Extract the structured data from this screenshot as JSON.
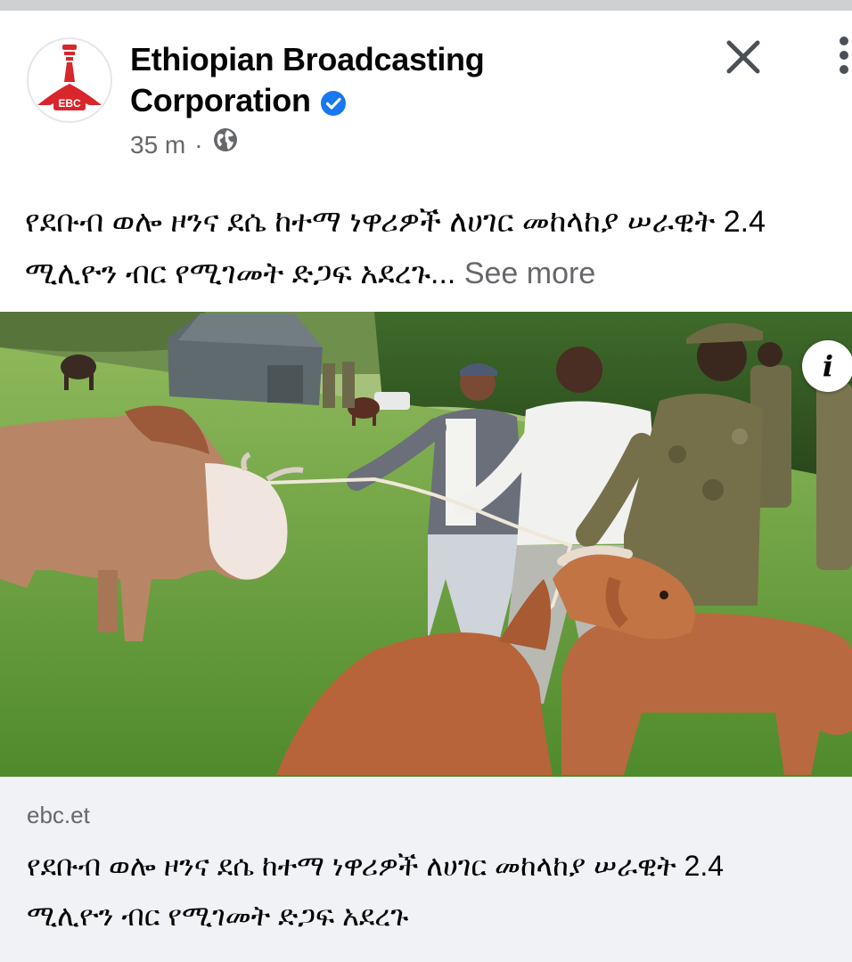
{
  "post": {
    "page_name_line1": "Ethiopian Broadcasting",
    "page_name_line2": "Corporation",
    "time": "35 m",
    "separator": "·",
    "avatar_logo_text": "EBC",
    "verified_icon": "verified-badge-icon",
    "audience_icon": "globe-icon",
    "text_line1": "የደቡብ ወሎ ዞንና ደሴ ከተማ ነዋሪዎች ለሀገር መከላከያ ሠራዊት 2.4",
    "text_line2": "ሚሊዮን ብር የሚገመት ድጋፍ አደረጉ...",
    "see_more": "See more"
  },
  "photo": {
    "description_icon": "info-icon",
    "info_label": "i"
  },
  "link_card": {
    "domain": "ebc.et",
    "title_line1": "የደቡብ ወሎ ዞንና ደሴ ከተማ ነዋሪዎች ለሀገር መከላከያ ሠራዊት 2.4",
    "title_line2": "ሚሊዮን ብር የሚገመት ድጋፍ አደረጉ"
  },
  "colors": {
    "verified_blue": "#1877f2",
    "secondary_text": "#65676b",
    "ebc_red": "#d8262b",
    "link_card_bg": "#f0f2f5"
  }
}
